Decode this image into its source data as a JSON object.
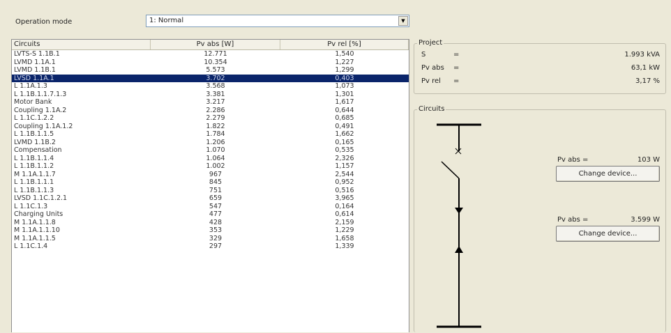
{
  "operation_mode": {
    "label": "Operation mode",
    "value": "1: Normal"
  },
  "table": {
    "columns": [
      "Circuits",
      "Pv abs [W]",
      "Pv rel [%]"
    ],
    "rows": [
      [
        "LVTS-S 1.1B.1",
        "12.771",
        "1,540"
      ],
      [
        "LVMD 1.1A.1",
        "10.354",
        "1,227"
      ],
      [
        "LVMD 1.1B.1",
        "5.573",
        "1,299"
      ],
      [
        "LVSD 1.1A.1",
        "3.702",
        "0,403"
      ],
      [
        "L 1.1A.1.3",
        "3.568",
        "1,073"
      ],
      [
        "L 1.1B.1.1.7.1.3",
        "3.381",
        "1,301"
      ],
      [
        "Motor Bank",
        "3.217",
        "1,617"
      ],
      [
        "Coupling 1.1A.2",
        "2.286",
        "0,644"
      ],
      [
        "L 1.1C.1.2.2",
        "2.279",
        "0,685"
      ],
      [
        "Coupling 1.1A.1.2",
        "1.822",
        "0,491"
      ],
      [
        "L 1.1B.1.1.5",
        "1.784",
        "1,662"
      ],
      [
        "LVMD 1.1B.2",
        "1.206",
        "0,165"
      ],
      [
        "Compensation",
        "1.070",
        "0,535"
      ],
      [
        "L 1.1B.1.1.4",
        "1.064",
        "2,326"
      ],
      [
        "L 1.1B.1.1.2",
        "1.002",
        "1,157"
      ],
      [
        "M 1.1A.1.1.7",
        "967",
        "2,544"
      ],
      [
        "L 1.1B.1.1.1",
        "845",
        "0,952"
      ],
      [
        "L 1.1B.1.1.3",
        "751",
        "0,516"
      ],
      [
        "LVSD 1.1C.1.2.1",
        "659",
        "3,965"
      ],
      [
        "L 1.1C.1.3",
        "547",
        "0,164"
      ],
      [
        "Charging Units",
        "477",
        "0,614"
      ],
      [
        "M 1.1A.1.1.8",
        "428",
        "2,159"
      ],
      [
        "M 1.1A.1.1.10",
        "353",
        "1,229"
      ],
      [
        "M 1.1A.1.1.5",
        "329",
        "1,658"
      ],
      [
        "L 1.1C.1.4",
        "297",
        "1,339"
      ]
    ],
    "selected_row": 3
  },
  "project": {
    "title": "Project",
    "rows": [
      {
        "name": "S",
        "eq": "=",
        "value": "1.993 kVA"
      },
      {
        "name": "Pv abs",
        "eq": "=",
        "value": "63,1 kW"
      },
      {
        "name": "Pv rel",
        "eq": "=",
        "value": "3,17 %"
      }
    ]
  },
  "circuits": {
    "title": "Circuits",
    "device1": {
      "label": "Pv abs =",
      "value": "103 W",
      "button": "Change device..."
    },
    "device2": {
      "label": "Pv abs =",
      "value": "3.599 W",
      "button": "Change device..."
    }
  }
}
